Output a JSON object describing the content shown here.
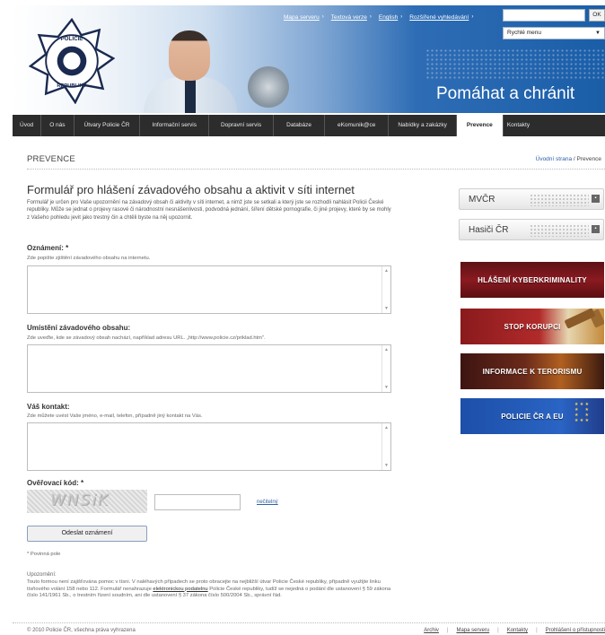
{
  "header": {
    "top_links": [
      "Mapa serveru",
      "Textová verze",
      "English",
      "Rozšířené vyhledávání"
    ],
    "search_button": "OK",
    "quick_menu": "Rychlé menu",
    "slogan": "Pomáhat a chránit",
    "logo_text": "POLICIE ČESKÉ REPUBLIKY"
  },
  "nav": {
    "items": [
      "Úvod",
      "O nás",
      "Útvary Policie ČR",
      "Informační servis",
      "Dopravní servis",
      "Databáze",
      "eKomunik@ce",
      "Nabídky a zakázky",
      "Prevence",
      "Kontakty"
    ],
    "active": "Prevence"
  },
  "breadcrumb": {
    "section": "PREVENCE",
    "home": "Úvodní strana",
    "separator": "/",
    "current": "Prevence"
  },
  "form": {
    "title": "Formulář pro hlášení závadového obsahu a aktivit v síti internet",
    "intro": "Formulář je určen pro Vaše upozornění na závadový obsah či aktivity v síti internet, a nimž jste se setkali a který jste se rozhodli nahlásit Policii České republiky. Může se jednat o projevy rasové či národnostní nesnášenlivosti, podvodná jednání, šíření dětské pornografie, či jiné projevy, které by se mohly z Vašeho pohledu jevit jako trestný čin a chtěli byste na něj upozornit.",
    "field1_label": "Oznámení: *",
    "field1_hint": "Zde popište zjištění závadového obsahu na internetu.",
    "field2_label": "Umístění závadového obsahu:",
    "field2_hint": "Zde uveďte, kde se závadový obsah nachází, například adresu URL. „http://www.policie.cz/priklad.htm\".",
    "field3_label": "Váš kontakt:",
    "field3_hint": "Zde můžete uvést Vaše jméno, e-mail, telefon, případně jiný kontakt na Vás.",
    "captcha_label": "Ověřovací kód: *",
    "captcha_text": "WNSiK",
    "unreadable_link": "nečitelný",
    "submit": "Odeslat oznámení",
    "required_note": "* Povinná pole",
    "warning_title": "Upozornění:",
    "warning_pre": "Touto formou není zajišťována pomoc v tísni. V naléhavých případech se proto obracejte na nejbližší útvar Policie České republiky, případně využijte linku tísňového volání 158 nebo 112. Formulář nenahrazuje ",
    "warning_link": "elektronickou podatelnu",
    "warning_post": " Policie České republiky, tudíž se nejedná o podání dle ustanovení § 59 zákona číslo 141/1961 Sb., o trestním řízení soudním, ani dle ustanovení § 37 zákona číslo 500/2004 Sb., správní řád."
  },
  "sidebar": {
    "buttons": [
      "MVČR",
      "Hasiči ČR"
    ],
    "banners": [
      "HLÁŠENÍ KYBERKRIMINALITY",
      "STOP KORUPCI",
      "INFORMACE K TERORISMU",
      "POLICIE ČR A EU"
    ]
  },
  "footer": {
    "copyright": "© 2010 Policie ČR, všechna práva vyhrazena",
    "links": [
      "Archiv",
      "Mapa serveru",
      "Kontakty",
      "Prohlášení o přístupnosti"
    ]
  }
}
